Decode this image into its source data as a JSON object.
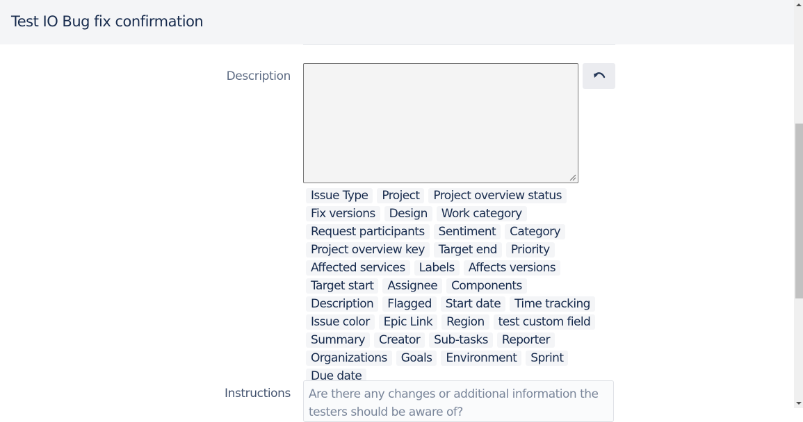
{
  "header": {
    "title": "Test IO Bug fix confirmation"
  },
  "description_field": {
    "label": "Description",
    "value": "",
    "undo_icon": "undo-icon"
  },
  "field_tags": [
    "Issue Type",
    "Project",
    "Project overview status",
    "Fix versions",
    "Design",
    "Work category",
    "Request participants",
    "Sentiment",
    "Category",
    "Project overview key",
    "Target end",
    "Priority",
    "Affected services",
    "Labels",
    "Affects versions",
    "Target start",
    "Assignee",
    "Components",
    "Description",
    "Flagged",
    "Start date",
    "Time tracking",
    "Issue color",
    "Epic Link",
    "Region",
    "test custom field",
    "Summary",
    "Creator",
    "Sub-tasks",
    "Reporter",
    "Organizations",
    "Goals",
    "Environment",
    "Sprint",
    "Due date"
  ],
  "instructions_field": {
    "label": "Instructions",
    "placeholder": "Are there any changes or additional information the testers should be aware of?"
  },
  "colors": {
    "header_bg": "#f4f5f7",
    "title_text": "#172b4d",
    "label_text": "#5e6c84",
    "tag_bg": "#f4f5f7"
  }
}
